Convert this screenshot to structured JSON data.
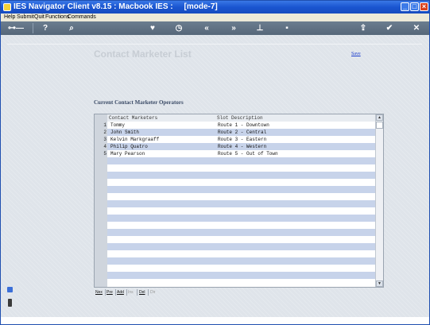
{
  "window": {
    "title": "IES Navigator Client v8.15 : Macbook IES :     [mode-7]"
  },
  "menu": {
    "items": [
      "Help",
      "Submit",
      "Quit",
      "Functions",
      "Commands"
    ]
  },
  "toolbar": {
    "icons": [
      "key-icon",
      "help-icon",
      "search-icon",
      "heart-icon",
      "clock-icon",
      "rewind-icon",
      "fast-forward-icon",
      "pin-icon",
      "square-icon",
      "upload-icon",
      "check-icon",
      "close-icon"
    ]
  },
  "page": {
    "title": "Contact Marketer List",
    "save_label": "Save",
    "section_label": "Current Contact Marketer Operators"
  },
  "grid": {
    "columns": [
      "Contact Marketers",
      "Slot Description"
    ],
    "rows": [
      {
        "num": "1",
        "name": "Tommy",
        "slot": "Route 1 - Downtown"
      },
      {
        "num": "2",
        "name": "John Smith",
        "slot": "Route 2 - Central"
      },
      {
        "num": "3",
        "name": "Kelvin Markgraaff",
        "slot": "Route 3 - Eastern"
      },
      {
        "num": "4",
        "name": "Philip Quatro",
        "slot": "Route 4 - Western"
      },
      {
        "num": "5",
        "name": "Mary Pearson",
        "slot": "Route 5 - Out of Town"
      }
    ]
  },
  "pager": {
    "buttons": [
      "Nex",
      "Pre",
      "Add",
      "Ins",
      "Del",
      "Dir"
    ]
  },
  "colors": {
    "titlebar": "#1a55d0",
    "row_highlight": "#c7d3ea",
    "link": "#1a3ccc"
  }
}
